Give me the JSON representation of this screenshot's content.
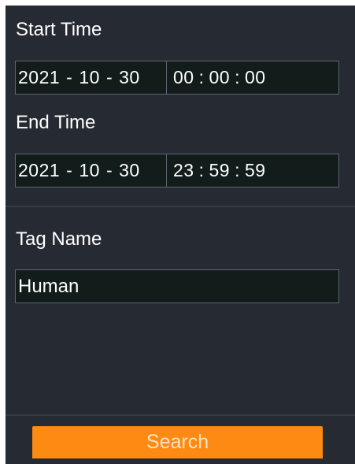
{
  "start_time": {
    "label": "Start Time",
    "year": "2021",
    "month": "10",
    "day": "30",
    "hour": "00",
    "minute": "00",
    "second": "00"
  },
  "end_time": {
    "label": "End Time",
    "year": "2021",
    "month": "10",
    "day": "30",
    "hour": "23",
    "minute": "59",
    "second": "59"
  },
  "tag": {
    "label": "Tag Name",
    "value": "Human"
  },
  "search_button": {
    "label": "Search"
  },
  "separators": {
    "date": "-",
    "time": ":"
  },
  "colors": {
    "panel_bg": "#262b33",
    "field_bg": "#121c1a",
    "accent": "#fd8a12"
  }
}
